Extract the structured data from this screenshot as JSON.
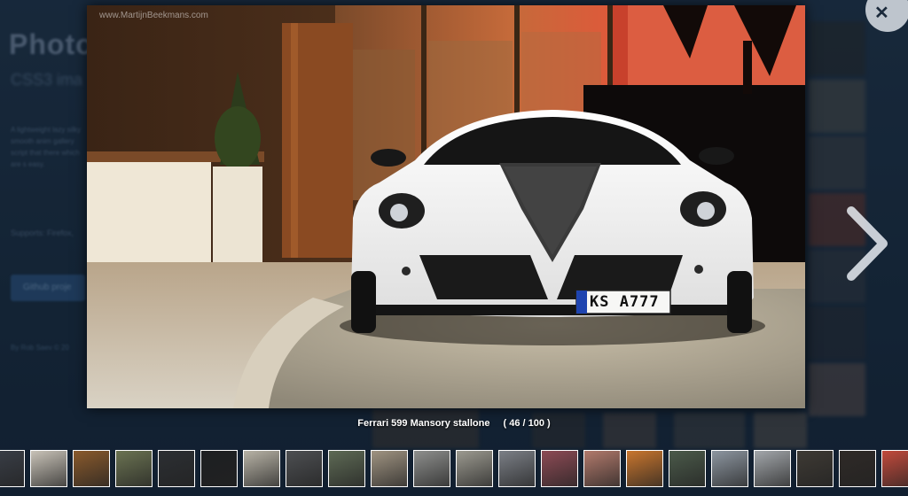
{
  "background_page": {
    "title": "Photo",
    "subtitle": "CSS3 ima",
    "paragraph": "A lightweight lazy silky smooth anim gallery script that there which are s easy.",
    "supports": "Supports: Firefox,",
    "github_button": "Github proje",
    "byline": "By Rob Saev © 20"
  },
  "lightbox": {
    "watermark": "www.MartijnBeekmans.com",
    "caption": "Ferrari 599 Mansory stallone",
    "counter": "( 46 / 100 )",
    "license_plate": "KS A777",
    "close_icon": "close-icon",
    "next_icon": "chevron-right-icon"
  },
  "thumbnails": [
    {
      "name": "thumb-1",
      "color": "#3a3f48"
    },
    {
      "name": "thumb-2",
      "color": "#c9c3b8"
    },
    {
      "name": "thumb-3",
      "color": "#8a5a2c"
    },
    {
      "name": "thumb-4",
      "color": "#6b7352"
    },
    {
      "name": "thumb-5",
      "color": "#2c2f33"
    },
    {
      "name": "thumb-6",
      "color": "#1d1f22"
    },
    {
      "name": "thumb-7",
      "color": "#b8b3a6"
    },
    {
      "name": "thumb-8",
      "color": "#4d4f52"
    },
    {
      "name": "thumb-9",
      "color": "#5e6a55"
    },
    {
      "name": "thumb-10",
      "color": "#a09482"
    },
    {
      "name": "thumb-11",
      "color": "#8e8f8d"
    },
    {
      "name": "thumb-12",
      "color": "#9c9a90"
    },
    {
      "name": "thumb-13",
      "color": "#7b7f86"
    },
    {
      "name": "thumb-14",
      "color": "#8d4b55"
    },
    {
      "name": "thumb-15",
      "color": "#b27a6c"
    },
    {
      "name": "thumb-16",
      "color": "#c9762e"
    },
    {
      "name": "thumb-17",
      "color": "#4b5a4a"
    },
    {
      "name": "thumb-18",
      "color": "#8d96a0"
    },
    {
      "name": "thumb-19",
      "color": "#a3a7ab"
    },
    {
      "name": "thumb-20",
      "color": "#3e3a34"
    },
    {
      "name": "thumb-21",
      "color": "#2f2a27"
    },
    {
      "name": "thumb-22",
      "color": "#c24a3c"
    }
  ]
}
